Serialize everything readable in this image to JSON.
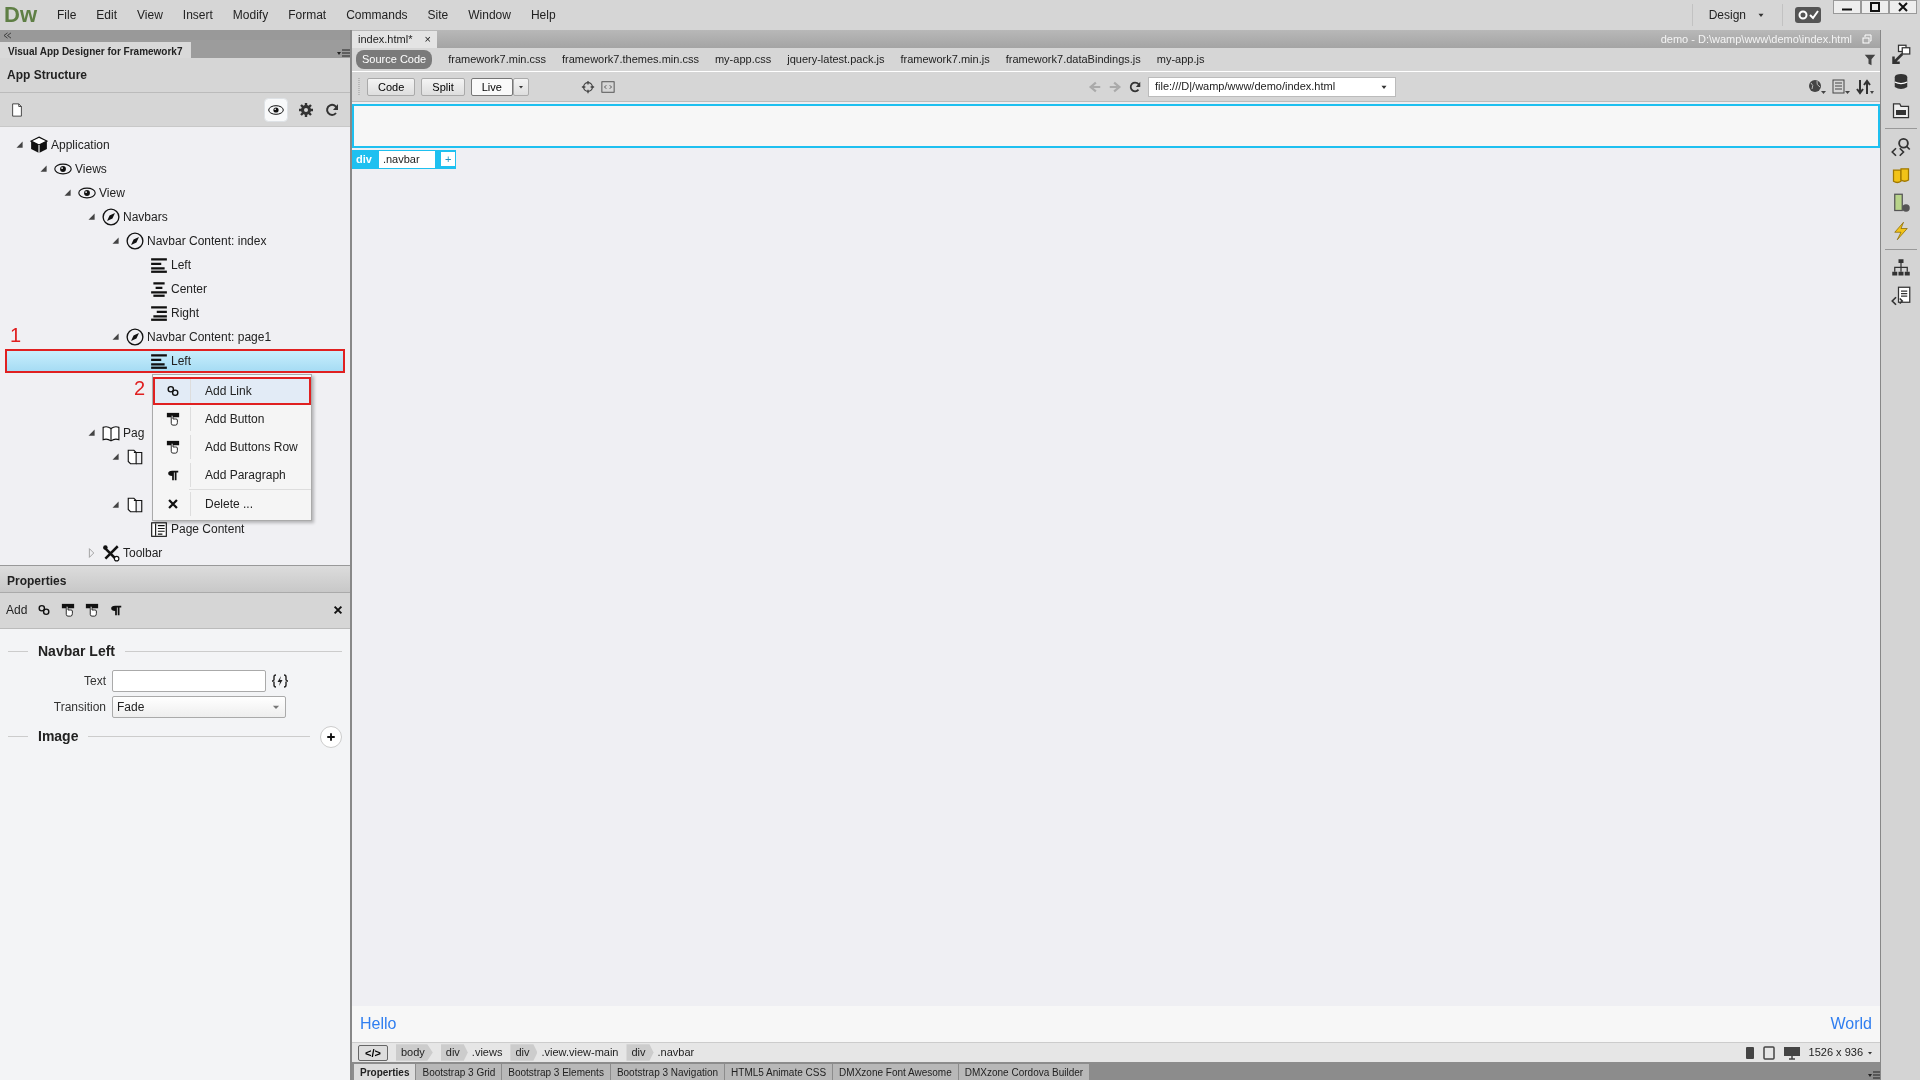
{
  "menubar": {
    "logo": "Dw",
    "menus": [
      "File",
      "Edit",
      "View",
      "Insert",
      "Modify",
      "Format",
      "Commands",
      "Site",
      "Window",
      "Help"
    ],
    "workspace": "Design"
  },
  "left_panel": {
    "tab": "Visual App Designer for Framework7",
    "title": "App Structure",
    "tree": [
      {
        "label": "Application",
        "kind": "application",
        "expanded": true,
        "selected": false,
        "children": [
          {
            "label": "Views",
            "kind": "views",
            "expanded": true,
            "selected": false,
            "children": [
              {
                "label": "View",
                "kind": "views",
                "expanded": true,
                "selected": false,
                "children": [
                  {
                    "label": "Navbars",
                    "kind": "navbar",
                    "expanded": true,
                    "selected": false,
                    "children": [
                      {
                        "label": "Navbar Content: index",
                        "kind": "navbar",
                        "expanded": true,
                        "selected": false,
                        "children": [
                          {
                            "label": "Left",
                            "kind": "left",
                            "selected": false
                          },
                          {
                            "label": "Center",
                            "kind": "center",
                            "selected": false
                          },
                          {
                            "label": "Right",
                            "kind": "right",
                            "selected": false
                          }
                        ]
                      },
                      {
                        "label": "Navbar Content: page1",
                        "kind": "navbar",
                        "expanded": true,
                        "selected": false,
                        "children": [
                          {
                            "label": "Left",
                            "kind": "left",
                            "selected": true
                          },
                          {
                            "selected": false
                          },
                          {
                            "selected": false
                          }
                        ]
                      }
                    ]
                  },
                  {
                    "label": "Pag",
                    "kind": "pages",
                    "expanded": true,
                    "selected": false,
                    "children": [
                      {
                        "kind": "page",
                        "expanded": true,
                        "selected": false,
                        "children": [
                          {
                            "selected": false
                          }
                        ]
                      },
                      {
                        "kind": "page",
                        "expanded": true,
                        "selected": false,
                        "children": [
                          {
                            "label": "Page Content",
                            "kind": "content",
                            "selected": false
                          }
                        ]
                      }
                    ]
                  },
                  {
                    "label": "Toolbar",
                    "kind": "toolbar",
                    "expanded": false,
                    "selected": false
                  }
                ]
              }
            ]
          }
        ]
      }
    ],
    "context_menu": [
      {
        "label": "Add Link",
        "kind": "link",
        "selected": true
      },
      {
        "label": "Add Button",
        "kind": "button",
        "selected": false
      },
      {
        "label": "Add Buttons Row",
        "kind": "button",
        "selected": false
      },
      {
        "label": "Add Paragraph",
        "kind": "paragraph",
        "selected": false
      },
      {
        "label": "Delete ...",
        "kind": "delete",
        "selected": false
      }
    ],
    "annotations": [
      {
        "label": "1"
      },
      {
        "label": "2"
      }
    ]
  },
  "properties": {
    "title": "Properties",
    "add_label": "Add",
    "section": "Navbar Left",
    "fields": [
      {
        "label": "Text",
        "kind": "text"
      },
      {
        "label": "Transition",
        "kind": "select",
        "value": "Fade"
      }
    ],
    "subsection": "Image"
  },
  "document": {
    "tab": "index.html*",
    "tab_close": "×",
    "path": "demo - D:\\wamp\\www\\demo\\index.html",
    "related_files": [
      {
        "label": "Source Code",
        "selected": true
      },
      {
        "label": "framework7.min.css",
        "selected": false
      },
      {
        "label": "framework7.themes.min.css",
        "selected": false
      },
      {
        "label": "my-app.css",
        "selected": false
      },
      {
        "label": "jquery-latest.pack.js",
        "selected": false
      },
      {
        "label": "framework7.min.js",
        "selected": false
      },
      {
        "label": "framework7.dataBindings.js",
        "selected": false
      },
      {
        "label": "my-app.js",
        "selected": false
      }
    ],
    "view_buttons": [
      {
        "label": "Code",
        "selected": false
      },
      {
        "label": "Split",
        "selected": false
      },
      {
        "label": "Live",
        "selected": true
      }
    ],
    "address": "file:///D|/wamp/www/demo/index.html",
    "live": {
      "element_tag": "div",
      "element_class": ".navbar",
      "add": "+",
      "left_text": "Hello",
      "right_text": "World"
    },
    "tag_selector": {
      "toggle": "</>",
      "tags": [
        {
          "tag": "body"
        },
        {
          "tag": "div",
          "class": ".views"
        },
        {
          "tag": "div",
          "class": ".view.view-main"
        },
        {
          "tag": "div",
          "class": ".navbar"
        }
      ]
    },
    "window_size": "1526 x 936"
  },
  "bottom_tabs": [
    {
      "label": "Properties",
      "selected": true
    },
    {
      "label": "Bootstrap 3 Grid",
      "selected": false
    },
    {
      "label": "Bootstrap 3 Elements",
      "selected": false
    },
    {
      "label": "Bootstrap 3 Navigation",
      "selected": false
    },
    {
      "label": "HTML5 Animate CSS",
      "selected": false
    },
    {
      "label": "DMXzone Font Awesome",
      "selected": false
    },
    {
      "label": "DMXzone Cordova Builder",
      "selected": false
    }
  ]
}
